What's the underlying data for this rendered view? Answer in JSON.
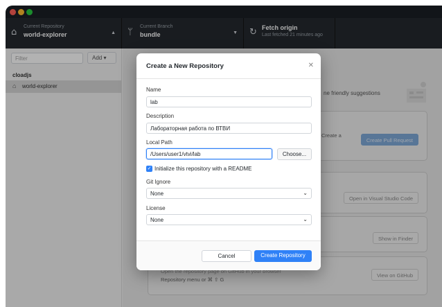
{
  "toolbar": {
    "repo": {
      "label": "Current Repository",
      "value": "world-explorer"
    },
    "branch": {
      "label": "Current Branch",
      "value": "bundle"
    },
    "fetch": {
      "label": "Fetch origin",
      "sub": "Last fetched 21 minutes ago"
    }
  },
  "sidebar": {
    "filter_placeholder": "Filter",
    "add_label": "Add ▾",
    "group": "cloadjs",
    "repos": [
      {
        "name": "world-explorer"
      }
    ]
  },
  "main": {
    "suggestions_text": "ne friendly suggestions",
    "card1_text": "Create a",
    "pull_request_button": "Create Pull Request",
    "open_vscode_button": "Open in Visual Studio Code",
    "show_finder_button": "Show in Finder",
    "view_github_button": "View on GitHub",
    "card4_line1": "Open the repository page on GitHub in your browser",
    "card4_line2": "Repository menu or ⌘ ⇧ G"
  },
  "dialog": {
    "title": "Create a New Repository",
    "name_label": "Name",
    "name_value": "lab",
    "description_label": "Description",
    "description_value": "Лабораторная работа по ВТВИ",
    "local_path_label": "Local Path",
    "local_path_value": "/Users/user1/vtvi/lab",
    "choose_button": "Choose...",
    "readme_checked": true,
    "readme_label": "Initialize this repository with a README",
    "gitignore_label": "Git Ignore",
    "gitignore_value": "None",
    "license_label": "License",
    "license_value": "None",
    "cancel_button": "Cancel",
    "create_button": "Create Repository"
  },
  "colors": {
    "accent": "#2f81f7",
    "toolbar_bg": "#24292e",
    "titlebar_bg": "#1b1f24"
  }
}
